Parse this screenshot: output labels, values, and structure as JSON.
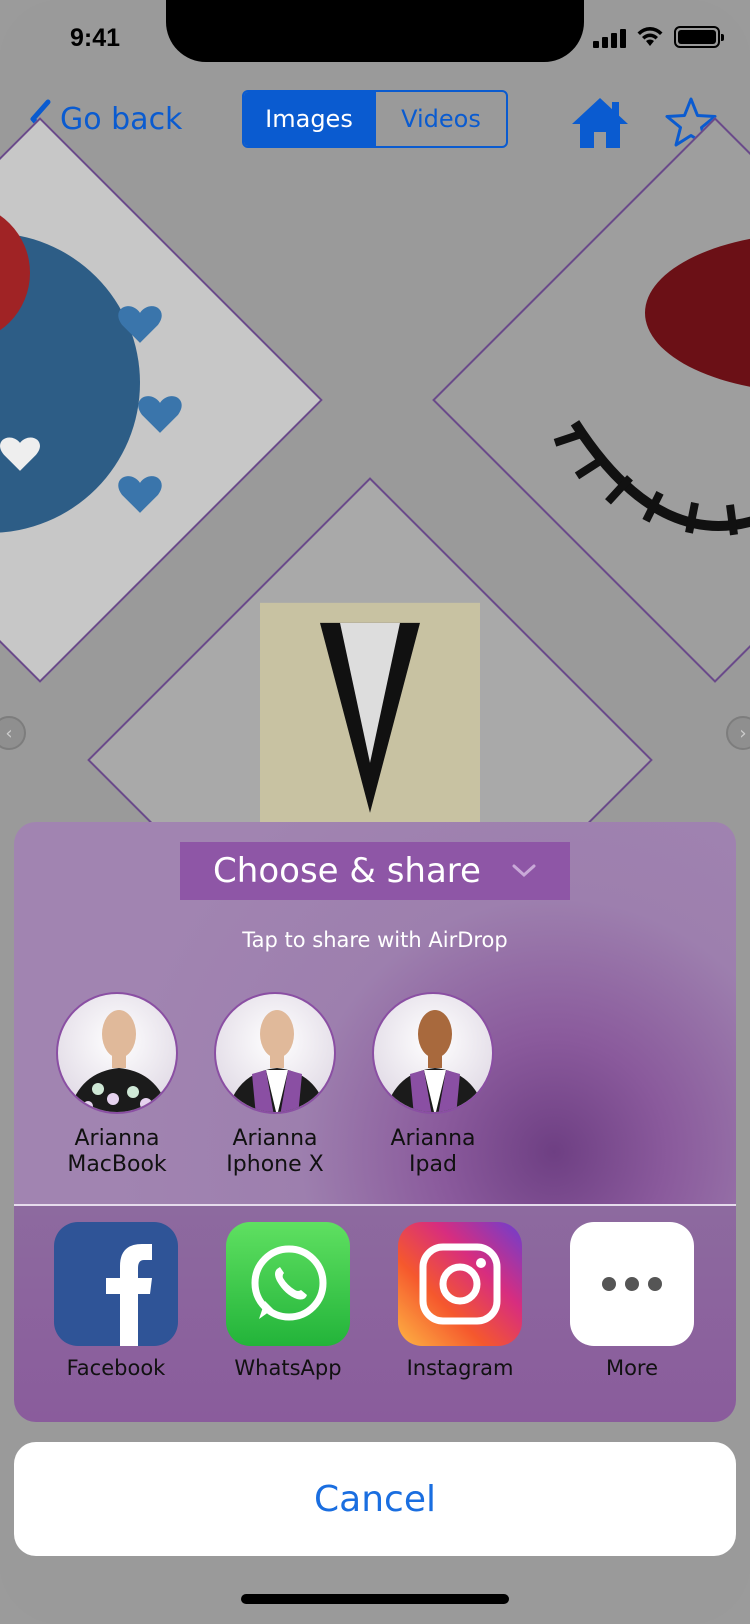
{
  "status": {
    "time": "9:41"
  },
  "nav": {
    "back_label": "Go back",
    "tabs": [
      "Images",
      "Videos"
    ],
    "active_tab": "Images"
  },
  "share": {
    "title": "Choose & share",
    "airdrop_hint": "Tap to share with AirDrop",
    "contacts": [
      {
        "line1": "Arianna",
        "line2": "MacBook"
      },
      {
        "line1": "Arianna",
        "line2": "Iphone X"
      },
      {
        "line1": "Arianna",
        "line2": "Ipad"
      }
    ],
    "apps": [
      {
        "label": "Facebook",
        "icon": "facebook-icon"
      },
      {
        "label": "WhatsApp",
        "icon": "whatsapp-icon"
      },
      {
        "label": "Instagram",
        "icon": "instagram-icon"
      },
      {
        "label": "More",
        "icon": "more-icon"
      }
    ],
    "cancel_label": "Cancel"
  },
  "colors": {
    "accent": "#0a5bd0",
    "share_header": "#8e56a6",
    "cancel_text": "#1a6ee0"
  }
}
